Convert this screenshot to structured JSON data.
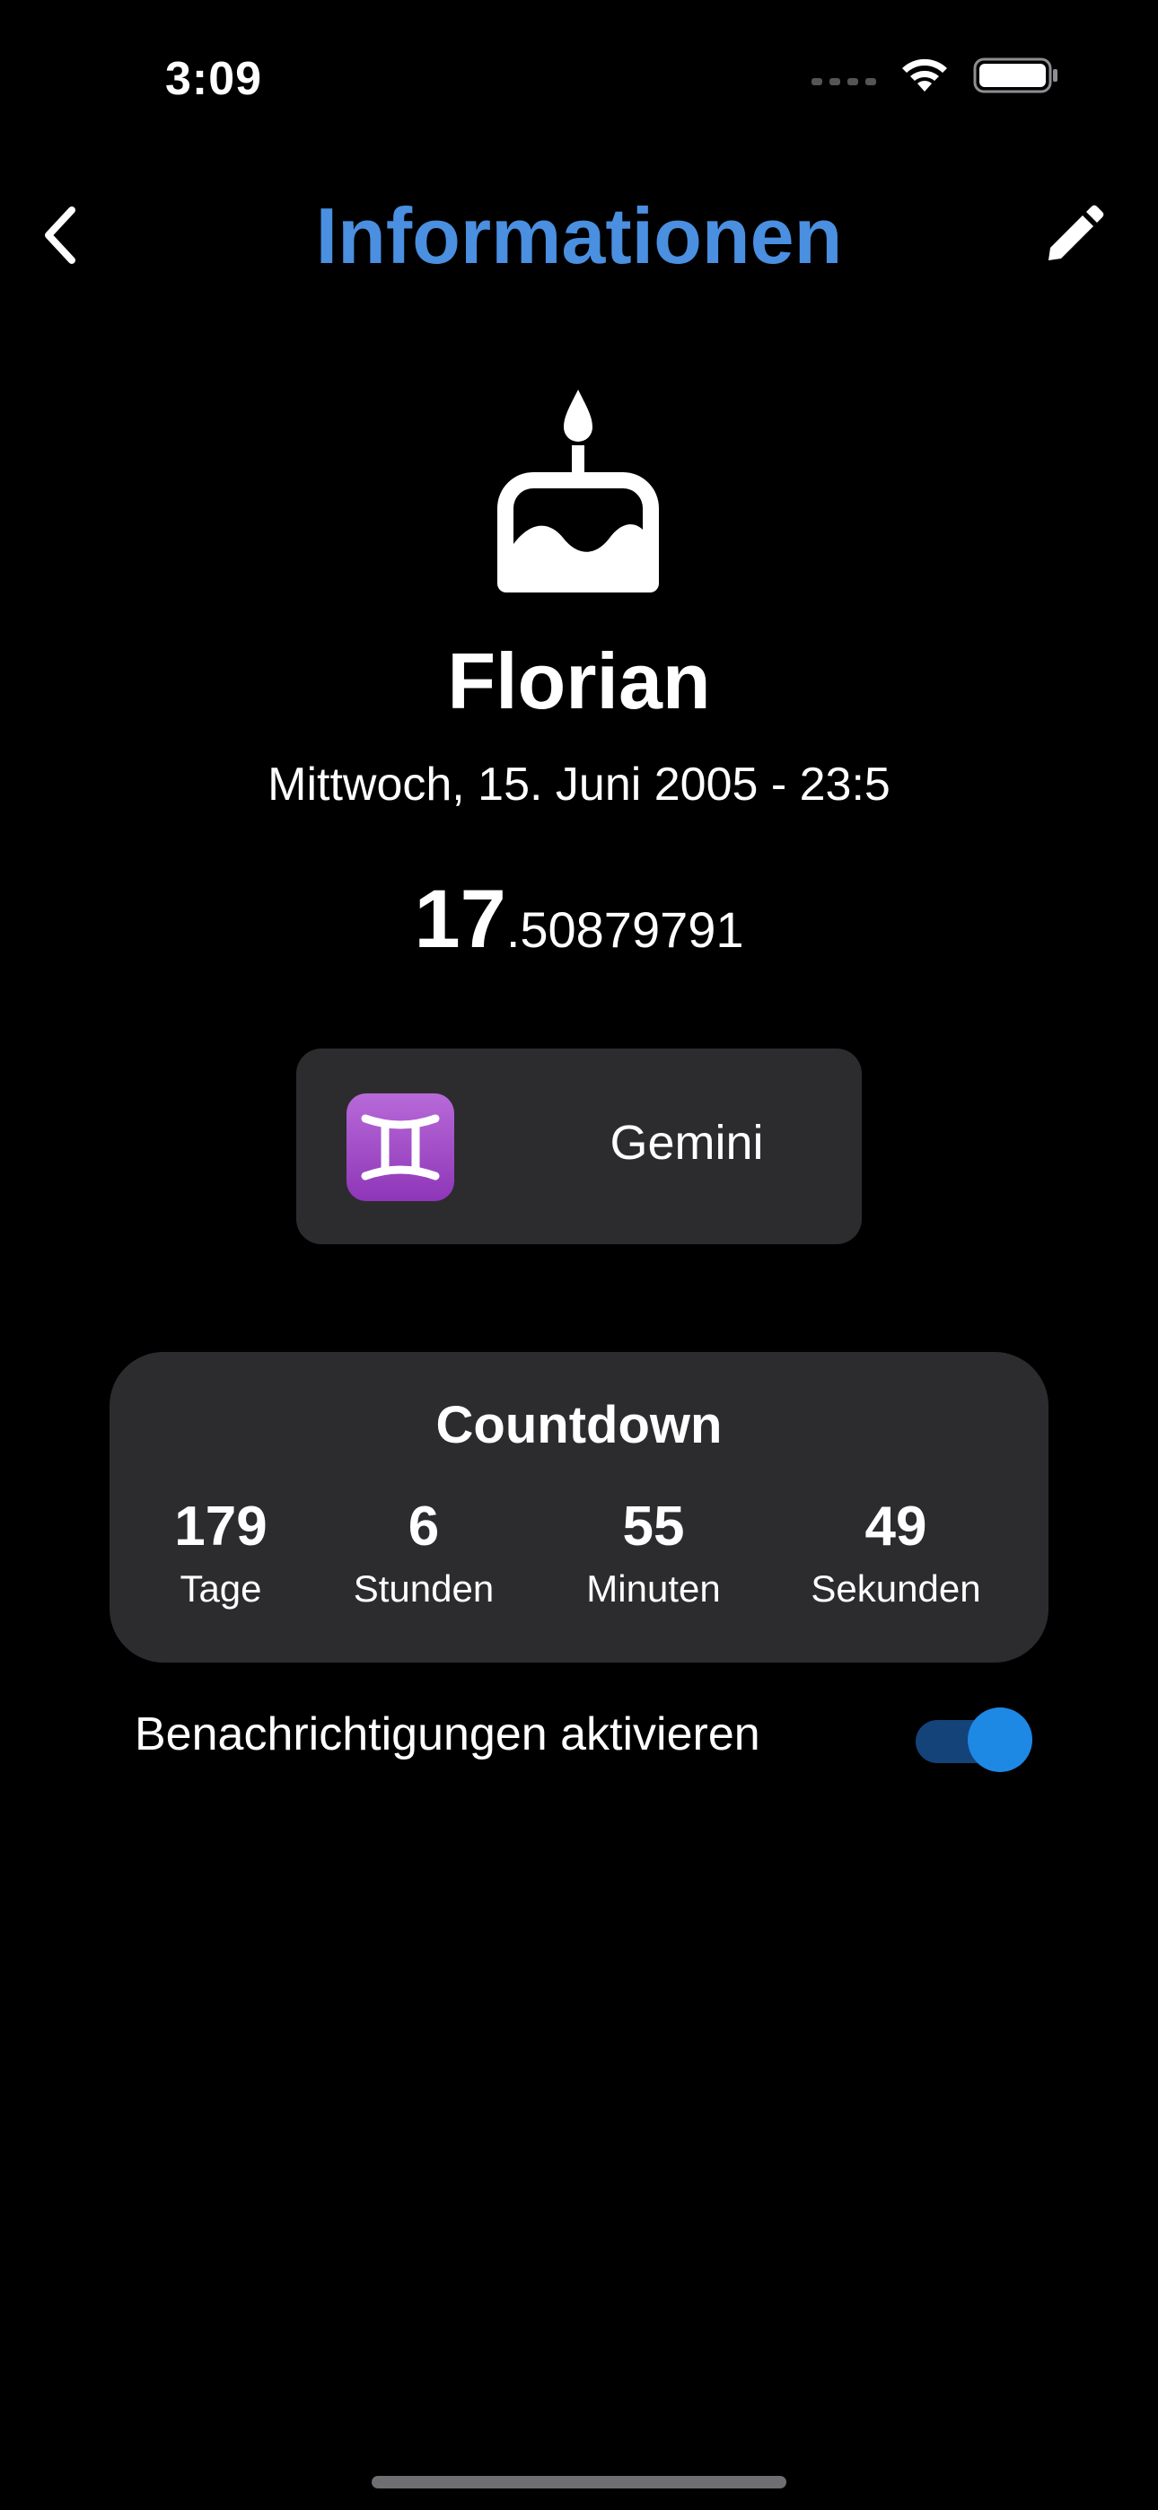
{
  "status_bar": {
    "time": "3:09",
    "icons": [
      "signal-icon",
      "wifi-icon",
      "battery-icon"
    ]
  },
  "nav": {
    "title": "Informationen",
    "back_icon": "chevron-left-icon",
    "edit_icon": "pencil-icon"
  },
  "profile": {
    "icon": "birthday-cake-icon",
    "name": "Florian",
    "birthdate": "Mittwoch, 15. Juni 2005 - 23:5",
    "age_integer": "17",
    "age_fraction": ".50879791"
  },
  "zodiac": {
    "symbol": "♊",
    "name": "Gemini"
  },
  "countdown": {
    "title": "Countdown",
    "items": [
      {
        "value": "179",
        "label": "Tage"
      },
      {
        "value": "6",
        "label": "Stunden"
      },
      {
        "value": "55",
        "label": "Minuten"
      },
      {
        "value": "49",
        "label": "Sekunden"
      }
    ]
  },
  "notifications": {
    "label": "Benachrichtigungen aktivieren",
    "enabled": true
  },
  "colors": {
    "accent": "#4a8fe0",
    "card": "#2c2c2e",
    "toggle_on": "#1e88e5"
  }
}
